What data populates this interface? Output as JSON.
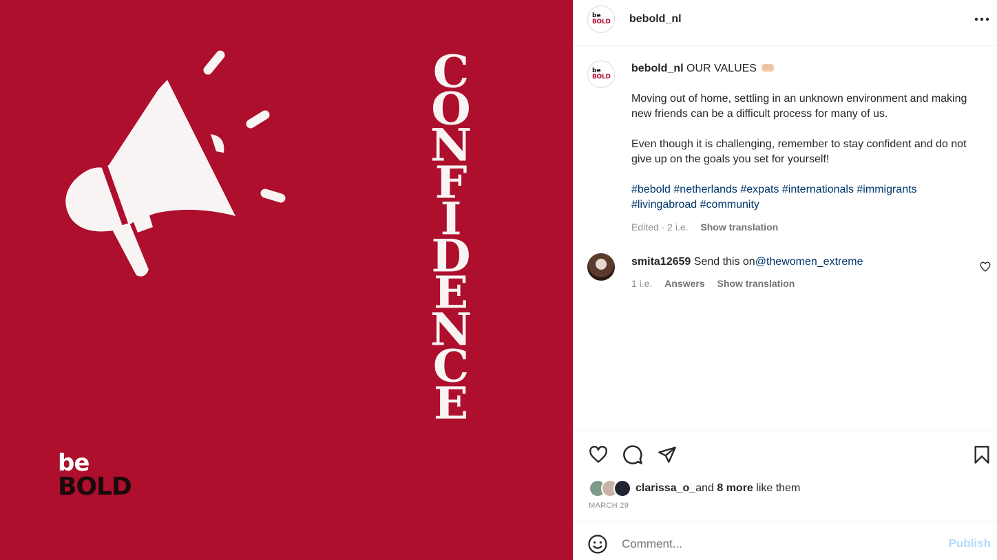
{
  "media": {
    "background_color": "#ad0f2d",
    "word_letters": [
      "C",
      "O",
      "N",
      "F",
      "I",
      "D",
      "E",
      "N",
      "C",
      "E"
    ],
    "logo_top": "be",
    "logo_bottom": "BOLD",
    "megaphone_icon": "megaphone-icon"
  },
  "header": {
    "avatar_top": "be",
    "avatar_bottom": "BOLD",
    "username": "bebold_nl",
    "more_icon": "more-horizontal-icon"
  },
  "caption": {
    "username": "bebold_nl",
    "title": "OUR VALUES",
    "emoji": "fist-bump-icon",
    "paragraph1": "Moving out of home, settling in an unknown environment and making new friends can be a difficult process for many of us.",
    "paragraph2": "Even though it is challenging, remember to stay confident and do not give up on the goals you set for yourself!",
    "hashtags": [
      "#bebold",
      "#netherlands",
      "#expats",
      "#internationals",
      "#immigrants",
      "#livingabroad",
      "#community"
    ],
    "edited": "Edited",
    "time": "· 2 i.e.",
    "show_translation": "Show translation"
  },
  "comment": {
    "username": "smita12659",
    "text": "Send this on",
    "mention": "@thewomen_extreme",
    "time": "1 i.e.",
    "answers": "Answers",
    "show_translation": "Show translation"
  },
  "actions": {
    "icons": [
      "heart-icon",
      "comment-icon",
      "share-icon",
      "bookmark-icon"
    ]
  },
  "likes": {
    "user": "clarissa_o_",
    "conj": "and",
    "more": "8 more",
    "suffix": "like them"
  },
  "date": "MARCH 29",
  "comment_box": {
    "placeholder": "Comment...",
    "publish": "Publish"
  }
}
